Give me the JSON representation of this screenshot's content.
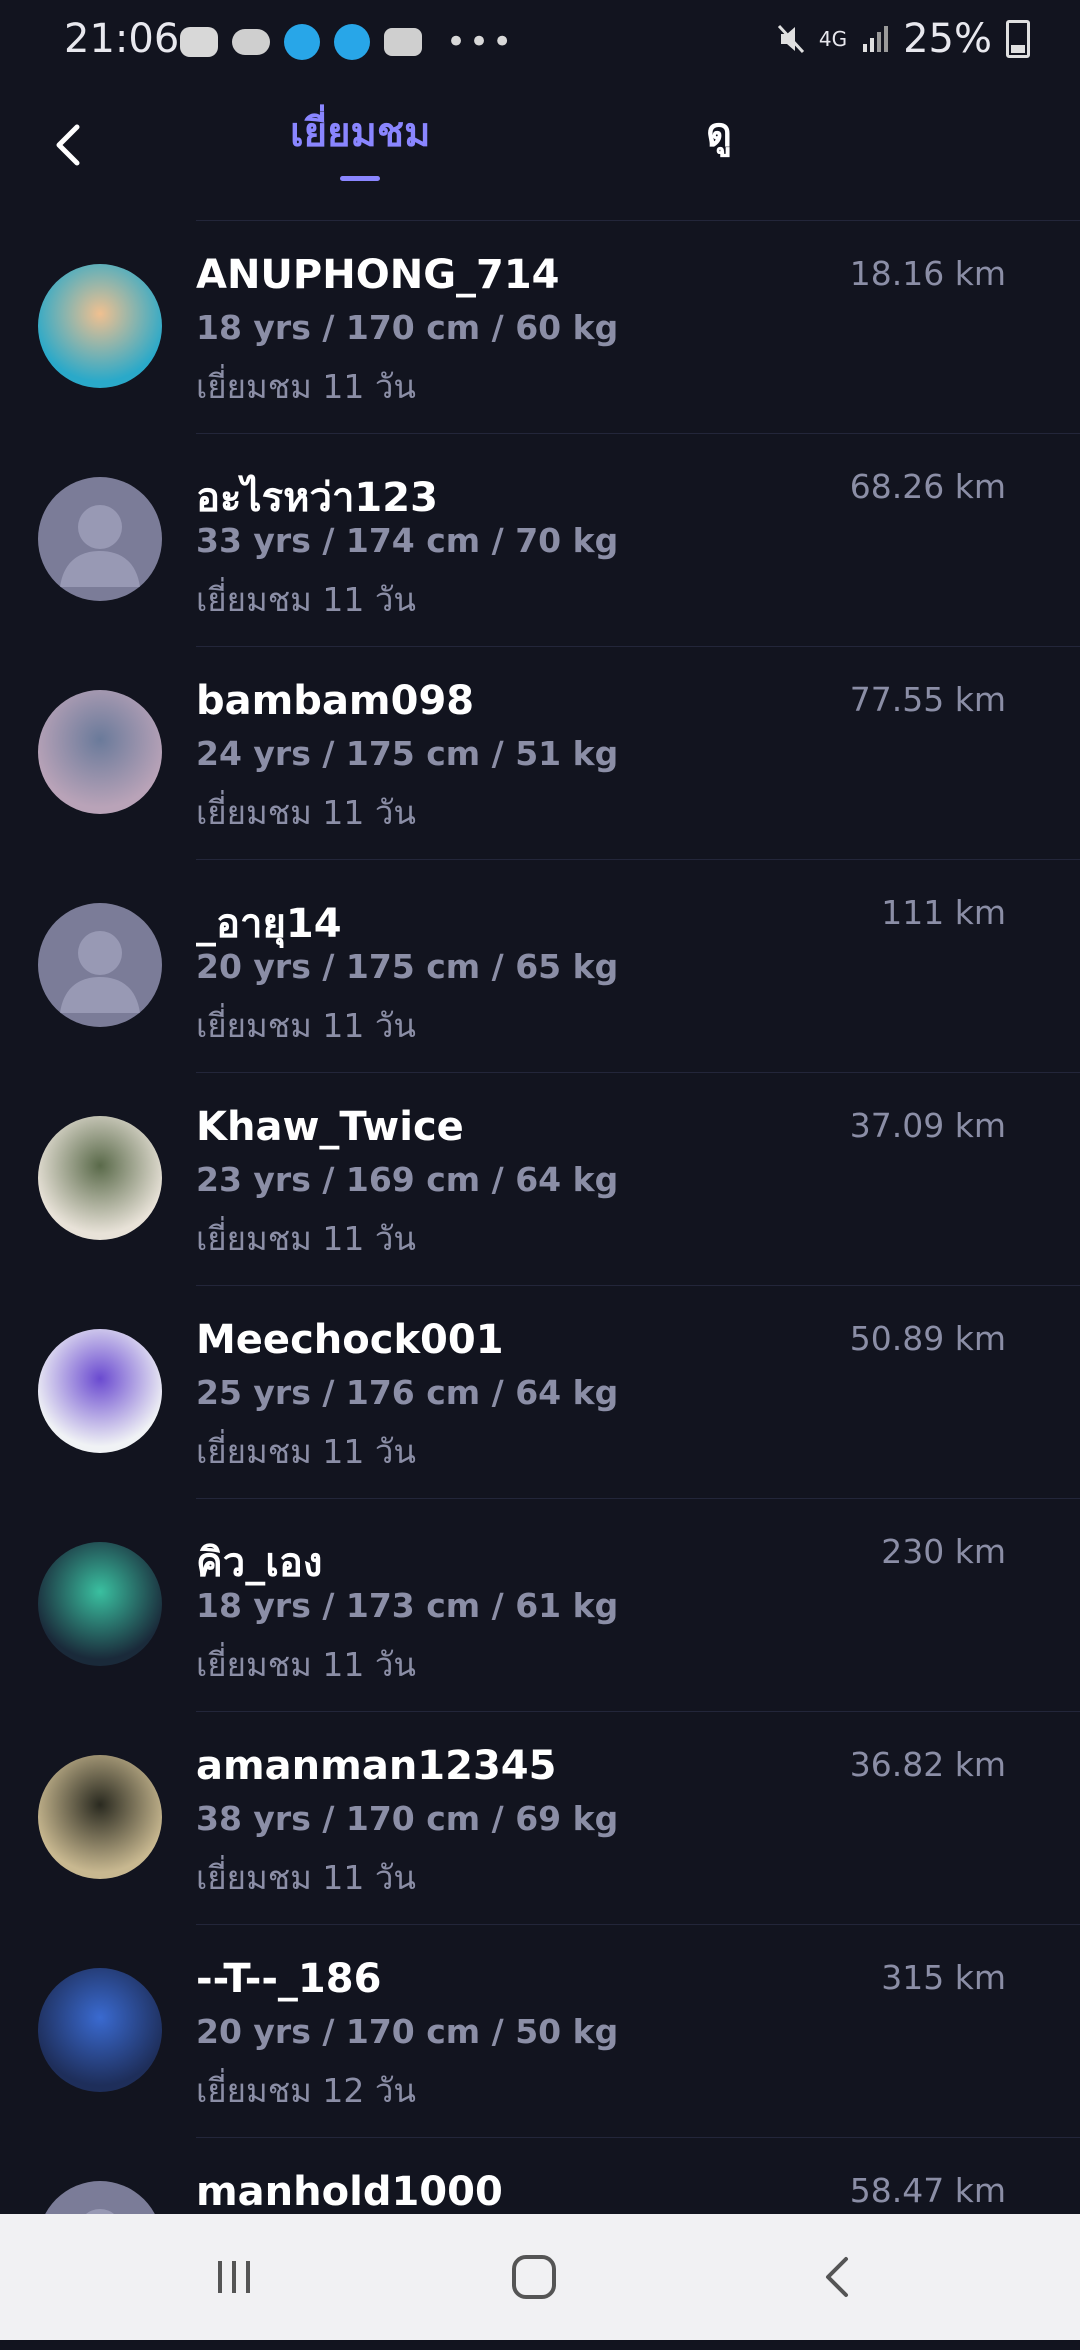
{
  "status_bar": {
    "time": "21:06",
    "signal_label": "4G",
    "battery": "25%",
    "more_icon": "•••"
  },
  "header": {
    "tab_visits": "เยี่ยมชม",
    "tab_watch": "ดู",
    "active_tab": "visits",
    "accent_color": "#8a86ff"
  },
  "users": [
    {
      "name": "ANUPHONG_714",
      "stats": "18 yrs / 170 cm / 60 kg",
      "visited": "เยี่ยมชม 11 วัน",
      "distance": "18.16 km",
      "avatar": "photo"
    },
    {
      "name": "อะไรหว่า123",
      "stats": "33 yrs / 174 cm / 70 kg",
      "visited": "เยี่ยมชม 11 วัน",
      "distance": "68.26 km",
      "avatar": "placeholder"
    },
    {
      "name": "bambam098",
      "stats": "24 yrs / 175 cm / 51 kg",
      "visited": "เยี่ยมชม 11 วัน",
      "distance": "77.55 km",
      "avatar": "photo"
    },
    {
      "name": "_อายุ14",
      "stats": "20 yrs / 175 cm / 65 kg",
      "visited": "เยี่ยมชม 11 วัน",
      "distance": "111 km",
      "avatar": "placeholder"
    },
    {
      "name": "Khaw_Twice",
      "stats": "23 yrs / 169 cm / 64 kg",
      "visited": "เยี่ยมชม 11 วัน",
      "distance": "37.09 km",
      "avatar": "photo"
    },
    {
      "name": "Meechock001",
      "stats": "25 yrs / 176 cm / 64 kg",
      "visited": "เยี่ยมชม 11 วัน",
      "distance": "50.89 km",
      "avatar": "photo"
    },
    {
      "name": "คิว_เอง",
      "stats": "18 yrs / 173 cm / 61 kg",
      "visited": "เยี่ยมชม 11 วัน",
      "distance": "230 km",
      "avatar": "photo"
    },
    {
      "name": "amanman12345",
      "stats": "38 yrs / 170 cm / 69 kg",
      "visited": "เยี่ยมชม 11 วัน",
      "distance": "36.82 km",
      "avatar": "photo"
    },
    {
      "name": "--T--_186",
      "stats": "20 yrs / 170 cm / 50 kg",
      "visited": "เยี่ยมชม 12 วัน",
      "distance": "315 km",
      "avatar": "photo"
    },
    {
      "name": "manhold1000",
      "stats": "",
      "visited": "",
      "distance": "58.47 km",
      "avatar": "placeholder"
    }
  ],
  "navbar": {
    "recents_icon": "recents-icon",
    "home_icon": "home-icon",
    "back_icon": "back-icon"
  }
}
